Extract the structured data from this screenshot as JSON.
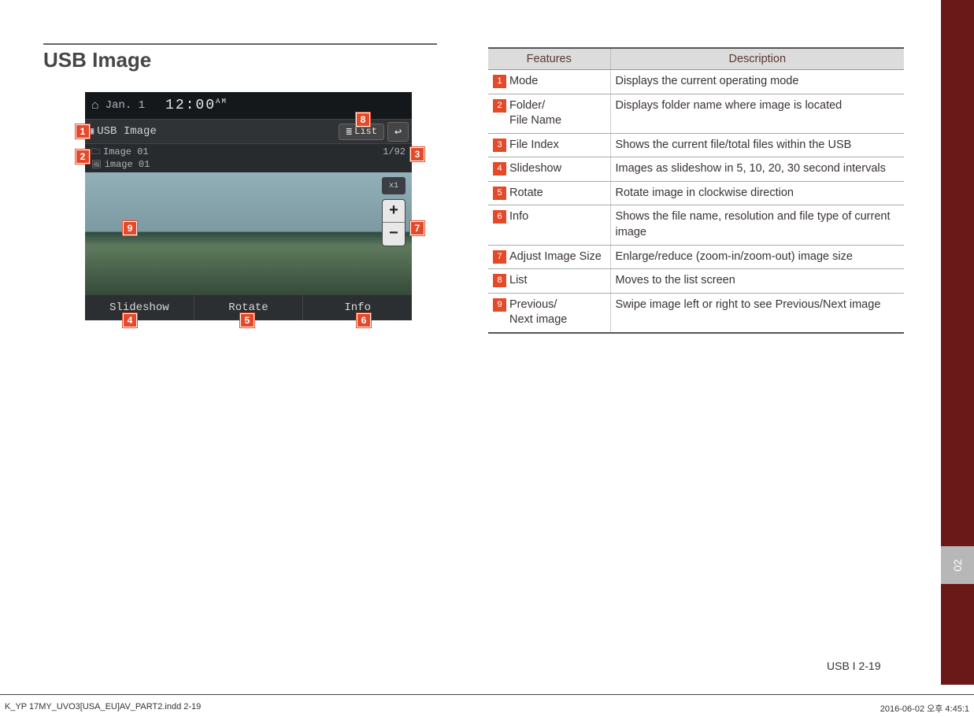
{
  "section_title": "USB Image",
  "tab_number": "02",
  "page_footer": "USB I 2-19",
  "print_footer_left": "K_YP 17MY_UVO3[USA_EU]AV_PART2.indd   2-19",
  "print_footer_right": "2016-06-02   오후 4:45:1",
  "screenshot": {
    "date": "Jan. 1",
    "time": "12:00",
    "ampm": "AM",
    "mode": "USB Image",
    "list_label": "List",
    "folder": "Image 01",
    "file": "image 01",
    "file_index": "1/92",
    "zoom_label": "x1",
    "slideshow": "Slideshow",
    "rotate": "Rotate",
    "info": "Info"
  },
  "callouts": {
    "c1": "1",
    "c2": "2",
    "c3": "3",
    "c4": "4",
    "c5": "5",
    "c6": "6",
    "c7": "7",
    "c8": "8",
    "c9": "9"
  },
  "table": {
    "head_features": "Features",
    "head_desc": "Description",
    "rows": [
      {
        "n": "1",
        "feature": "Mode",
        "desc": "Displays the current operating mode"
      },
      {
        "n": "2",
        "feature": "Folder/\nFile Name",
        "desc": "Displays folder name where image is located"
      },
      {
        "n": "3",
        "feature": "File Index",
        "desc": "Shows the current file/total files within the USB"
      },
      {
        "n": "4",
        "feature": "Slideshow",
        "desc": "Images as slideshow in 5, 10, 20, 30 second intervals"
      },
      {
        "n": "5",
        "feature": "Rotate",
        "desc": "Rotate image in clockwise direction"
      },
      {
        "n": "6",
        "feature": "Info",
        "desc": "Shows the file name, resolution and file type of current image"
      },
      {
        "n": "7",
        "feature": "Adjust Image Size",
        "desc": "Enlarge/reduce (zoom-in/zoom-out) image size"
      },
      {
        "n": "8",
        "feature": "List",
        "desc": "Moves to the list screen"
      },
      {
        "n": "9",
        "feature": "Previous/\nNext image",
        "desc": "Swipe image left or right to see Previous/Next image"
      }
    ]
  }
}
